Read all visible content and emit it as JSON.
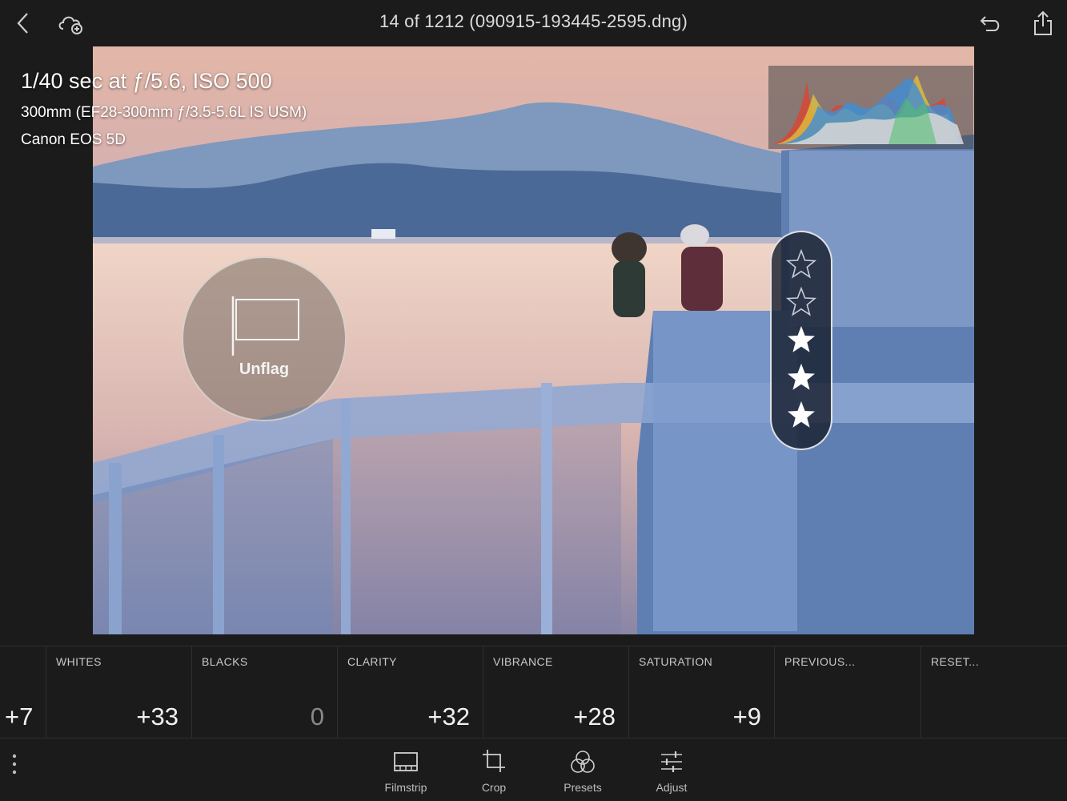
{
  "header": {
    "title": "14 of 1212 (090915-193445-2595.dng)",
    "icons": [
      "back-icon",
      "cloud-add-icon",
      "undo-icon",
      "share-icon"
    ]
  },
  "photo_info": {
    "exposure": "1/40 sec at ƒ/5.6, ISO 500",
    "lens": "300mm (EF28-300mm ƒ/3.5-5.6L IS USM)",
    "camera": "Canon EOS 5D"
  },
  "flag_overlay": {
    "label": "Unflag"
  },
  "rating": {
    "stars_total": 5,
    "filled_from_bottom": 3
  },
  "adjustments": {
    "partial_value": "+7",
    "items": [
      {
        "label": "WHITES",
        "value": "+33"
      },
      {
        "label": "BLACKS",
        "value": "0"
      },
      {
        "label": "CLARITY",
        "value": "+32"
      },
      {
        "label": "VIBRANCE",
        "value": "+28"
      },
      {
        "label": "SATURATION",
        "value": "+9"
      },
      {
        "label": "PREVIOUS...",
        "value": ""
      },
      {
        "label": "RESET...",
        "value": ""
      }
    ]
  },
  "toolbar": {
    "items": [
      {
        "label": "Filmstrip",
        "icon": "filmstrip-icon"
      },
      {
        "label": "Crop",
        "icon": "crop-icon"
      },
      {
        "label": "Presets",
        "icon": "presets-icon"
      },
      {
        "label": "Adjust",
        "icon": "adjust-sliders-icon"
      }
    ]
  }
}
